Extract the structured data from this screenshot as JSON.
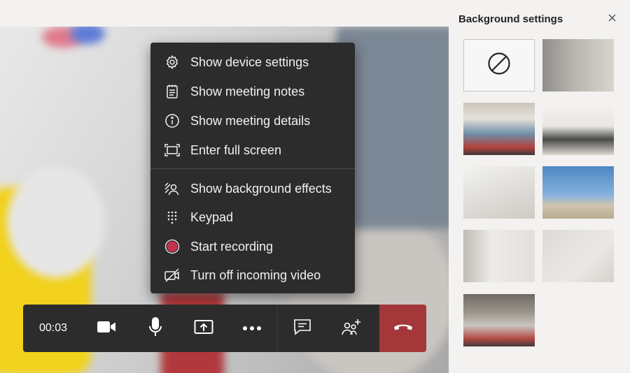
{
  "meeting": {
    "elapsed_time": "00:03",
    "menu": {
      "items": [
        {
          "label": "Show device settings",
          "icon": "gear-icon"
        },
        {
          "label": "Show meeting notes",
          "icon": "notes-icon"
        },
        {
          "label": "Show meeting details",
          "icon": "info-icon"
        },
        {
          "label": "Enter full screen",
          "icon": "fullscreen-icon"
        },
        {
          "label": "Show background effects",
          "icon": "background-effects-icon"
        },
        {
          "label": "Keypad",
          "icon": "keypad-icon"
        },
        {
          "label": "Start recording",
          "icon": "record-icon"
        },
        {
          "label": "Turn off incoming video",
          "icon": "video-off-icon"
        }
      ]
    },
    "toolbar": {
      "buttons": [
        "camera-icon",
        "microphone-icon",
        "share-screen-icon",
        "more-options-icon",
        "chat-icon",
        "participants-icon",
        "hang-up-icon"
      ]
    }
  },
  "background_settings": {
    "title": "Background settings",
    "thumbnails": [
      "none",
      "blur",
      "office-hallway",
      "loft-room",
      "white-room",
      "beach-lifeguard-tower",
      "empty-white-room",
      "soft-gradient",
      "industrial-loft"
    ]
  },
  "colors": {
    "menu_bg": "#2d2c2c",
    "end_call": "#a4373a",
    "record_dot": "#c4314b",
    "panel_bg": "#f3f2f1"
  }
}
